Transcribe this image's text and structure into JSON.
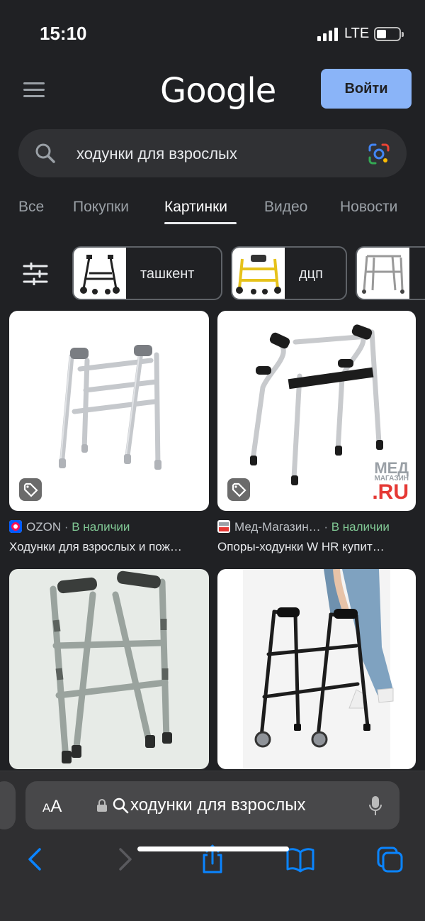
{
  "status": {
    "time": "15:10",
    "network": "LTE"
  },
  "header": {
    "logo": "Google",
    "signin_label": "Войти"
  },
  "search": {
    "query": "ходунки для взрослых"
  },
  "tabs": [
    {
      "label": "Все"
    },
    {
      "label": "Покупки"
    },
    {
      "label": "Картинки"
    },
    {
      "label": "Видео"
    },
    {
      "label": "Новости"
    }
  ],
  "chips": [
    {
      "label": "ташкент"
    },
    {
      "label": "дцп"
    }
  ],
  "results": [
    {
      "source": "OZON",
      "separator": "·",
      "availability": "В наличии",
      "title": "Ходунки для взрослых и пож…"
    },
    {
      "source": "Мед-Магазин…",
      "separator": "·",
      "availability": "В наличии",
      "title": "Опоры-ходунки W HR купит…",
      "watermark": [
        "МЕД",
        "МАГАЗИН",
        ".RU"
      ]
    },
    {},
    {}
  ],
  "browser": {
    "text_size_label": "AA",
    "url": "ходунки для взрослых"
  },
  "colors": {
    "background": "#202124",
    "accent": "#8ab4f8",
    "in_stock": "#81c995",
    "safari_blue": "#0a84ff"
  }
}
